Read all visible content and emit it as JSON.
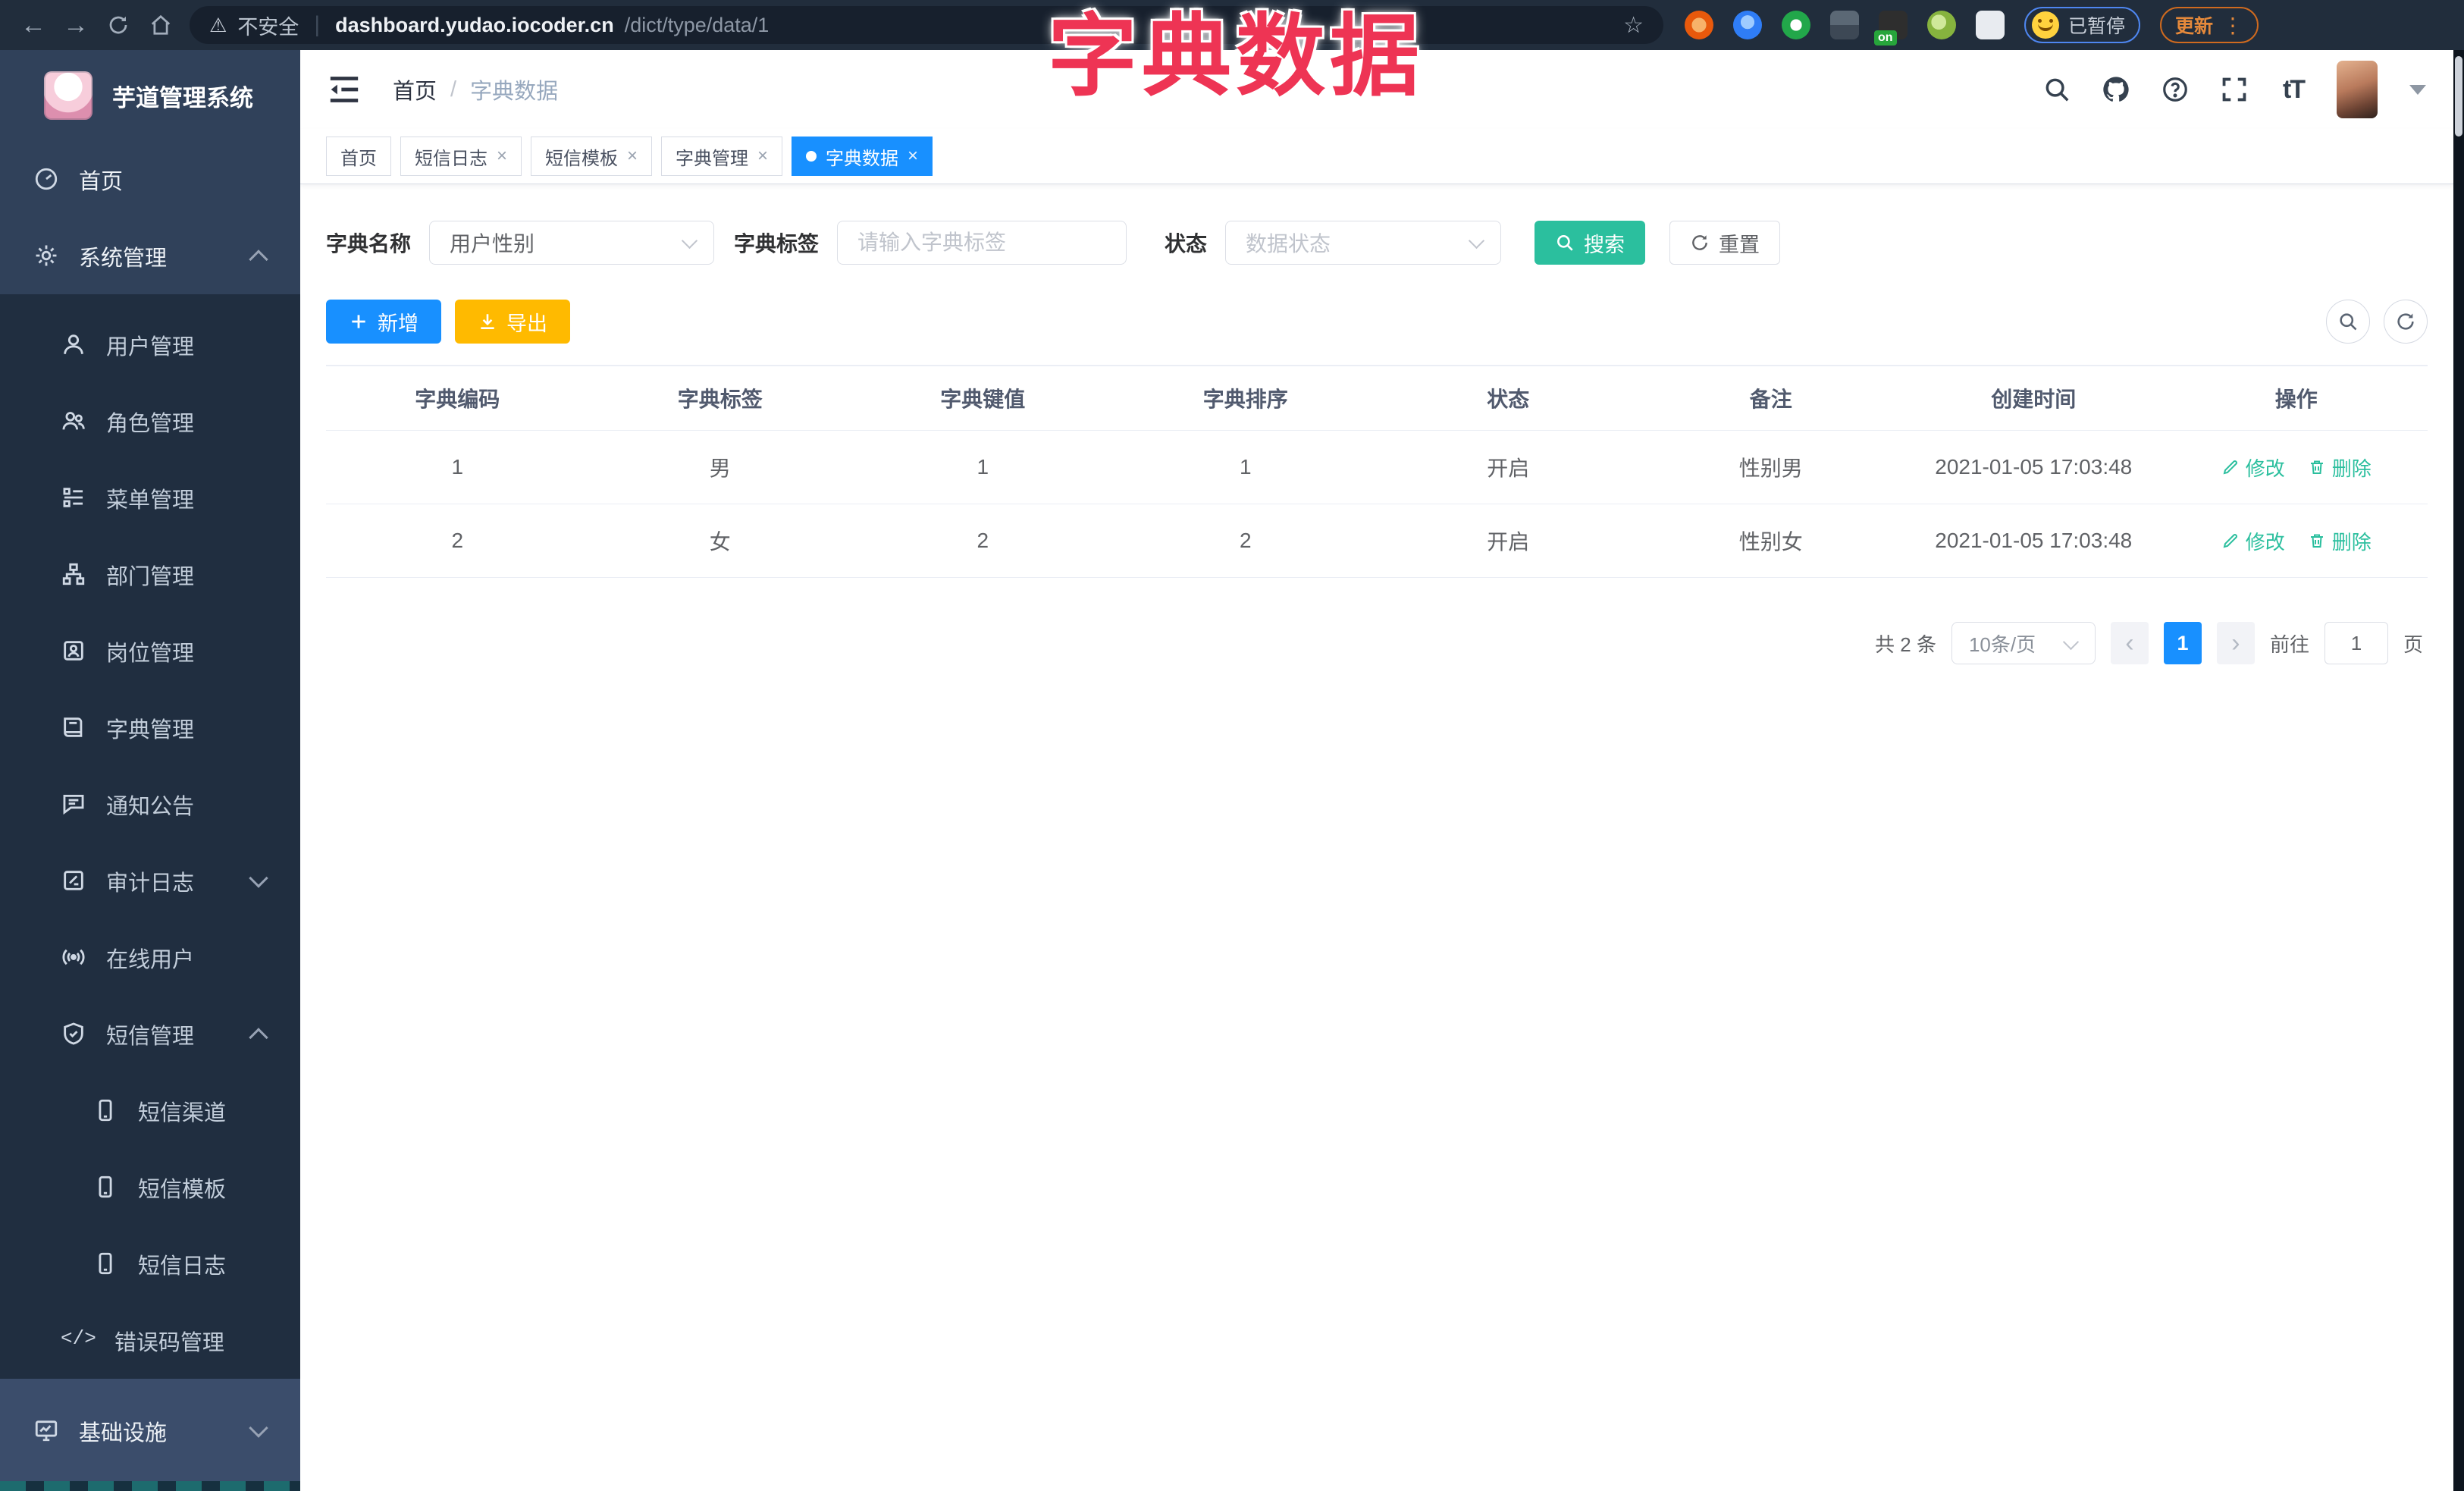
{
  "browser": {
    "security_label": "不安全",
    "url_domain": "dashboard.yudao.iocoder.cn",
    "url_path": "/dict/type/data/1",
    "profile_status": "已暂停",
    "update_label": "更新",
    "on_badge": "on"
  },
  "icons": {
    "back": "←",
    "forward": "→",
    "star": "☆",
    "warning": "⚠",
    "separator": "|",
    "close": "×",
    "slash": "/",
    "prev": "‹",
    "next": "›",
    "font_size": "tT",
    "help": "?",
    "code": "</>",
    "ellipsis": "⋮"
  },
  "overlay_title": "字典数据",
  "sidebar": {
    "app_title": "芋道管理系统",
    "items": [
      {
        "label": "首页"
      },
      {
        "label": "系统管理"
      },
      {
        "label": "用户管理"
      },
      {
        "label": "角色管理"
      },
      {
        "label": "菜单管理"
      },
      {
        "label": "部门管理"
      },
      {
        "label": "岗位管理"
      },
      {
        "label": "字典管理"
      },
      {
        "label": "通知公告"
      },
      {
        "label": "审计日志"
      },
      {
        "label": "在线用户"
      },
      {
        "label": "短信管理"
      },
      {
        "label": "短信渠道"
      },
      {
        "label": "短信模板"
      },
      {
        "label": "短信日志"
      },
      {
        "label": "错误码管理"
      },
      {
        "label": "基础设施"
      }
    ]
  },
  "header": {
    "breadcrumb_home": "首页",
    "breadcrumb_current": "字典数据"
  },
  "tabs": {
    "items": [
      {
        "label": "首页"
      },
      {
        "label": "短信日志"
      },
      {
        "label": "短信模板"
      },
      {
        "label": "字典管理"
      },
      {
        "label": "字典数据"
      }
    ]
  },
  "filters": {
    "dict_name_label": "字典名称",
    "dict_name_value": "用户性别",
    "dict_label_label": "字典标签",
    "dict_label_placeholder": "请输入字典标签",
    "status_label": "状态",
    "status_placeholder": "数据状态",
    "search_label": "搜索",
    "reset_label": "重置"
  },
  "toolbar": {
    "add_label": "新增",
    "export_label": "导出"
  },
  "table": {
    "columns": [
      "字典编码",
      "字典标签",
      "字典键值",
      "字典排序",
      "状态",
      "备注",
      "创建时间",
      "操作"
    ],
    "rows": [
      {
        "code": "1",
        "label": "男",
        "value": "1",
        "sort": "1",
        "status": "开启",
        "remark": "性别男",
        "created": "2021-01-05 17:03:48",
        "edit": "修改",
        "delete": "删除"
      },
      {
        "code": "2",
        "label": "女",
        "value": "2",
        "sort": "2",
        "status": "开启",
        "remark": "性别女",
        "created": "2021-01-05 17:03:48",
        "edit": "修改",
        "delete": "删除"
      }
    ]
  },
  "pagination": {
    "total": "共 2 条",
    "page_size": "10条/页",
    "current_page": "1",
    "goto_label": "前往",
    "goto_value": "1",
    "page_unit": "页"
  },
  "colors": {
    "primary_blue": "#1890ff",
    "teal_accent": "#2bbf9e",
    "warning_orange": "#ffba00",
    "annotation_pink": "#ee3454",
    "sidebar_bg": "#30415a",
    "submenu_bg": "#202e40",
    "chrome_bg": "#212d3c"
  }
}
